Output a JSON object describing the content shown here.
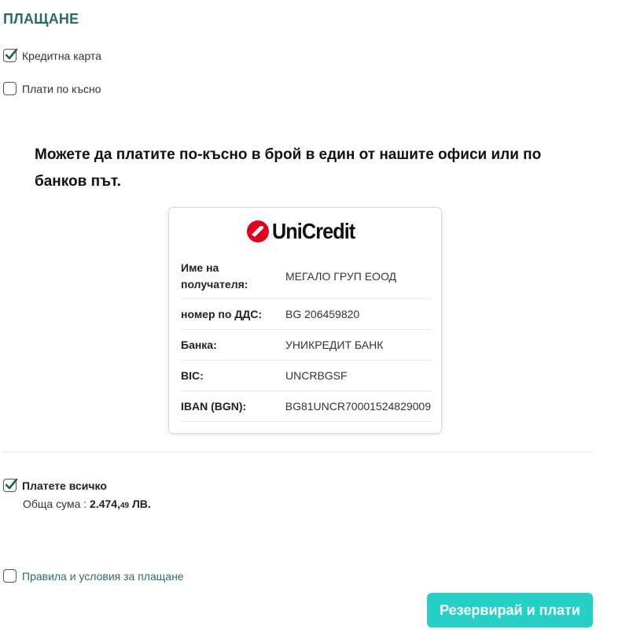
{
  "section_title": "ПЛАЩАНЕ",
  "payment_options": [
    {
      "label": "Кредитна карта",
      "checked": true
    },
    {
      "label": "Плати по късно",
      "checked": false
    }
  ],
  "pay_later_info": "Можете да платите по-късно в брой в един от нашите офиси или по банков път.",
  "bank": {
    "logo_text": "UniCredit",
    "brand_color": "#e2001a",
    "rows": [
      {
        "label": "Име на получателя:",
        "value": "МЕГАЛО ГРУП ЕООД"
      },
      {
        "label": "номер по ДДС:",
        "value": "BG 206459820"
      },
      {
        "label": "Банка:",
        "value": "УНИКРЕДИТ БАНК"
      },
      {
        "label": "BIC:",
        "value": "UNCRBGSF"
      },
      {
        "label": "IBAN (BGN):",
        "value": "BG81UNCR70001524829009"
      }
    ]
  },
  "pay_all": {
    "label": "Платете всичко",
    "checked": true,
    "total_label": "Обща сума :",
    "total_main": "2.474,",
    "total_decimals": "49",
    "currency": "ЛВ."
  },
  "terms": {
    "label": "Правила и условия за плащане",
    "checked": false
  },
  "submit_label": "Резервирай и плати",
  "colors": {
    "accent": "#25d0c6",
    "title": "#2b6b6b",
    "check": "#1f5e5e"
  }
}
